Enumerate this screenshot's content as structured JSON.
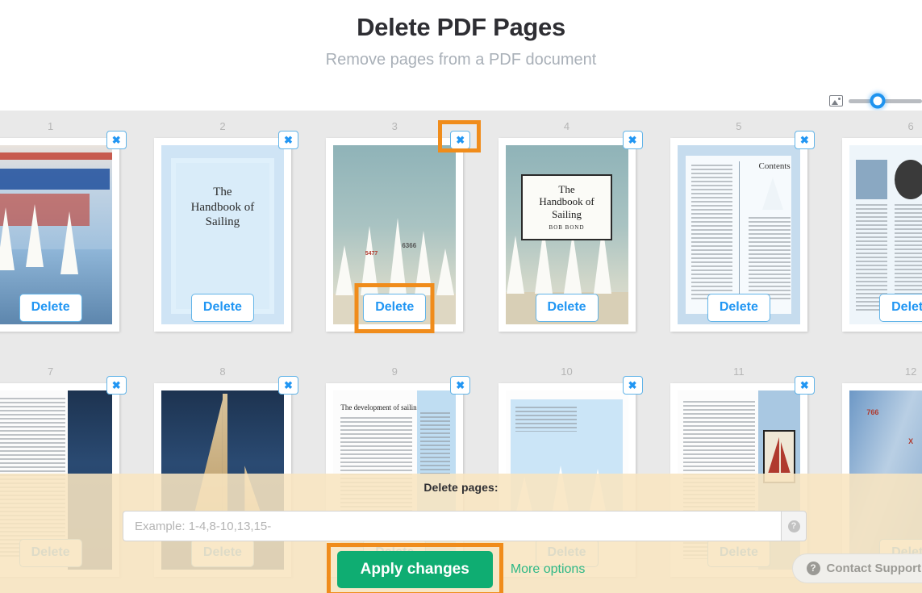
{
  "header": {
    "title": "Delete PDF Pages",
    "subtitle": "Remove pages from a PDF document"
  },
  "zoom_control": {
    "icon": "image-icon",
    "handle_position_percent": 40
  },
  "grid": {
    "close_label": "✖",
    "delete_label": "Delete",
    "pages": [
      {
        "number": "1",
        "art": "cover-photo",
        "title": ""
      },
      {
        "number": "2",
        "art": "pale-blue-title",
        "title": "The\nHandbook of\nSailing"
      },
      {
        "number": "3",
        "art": "sails-sky",
        "title": "",
        "highlighted": true
      },
      {
        "number": "4",
        "art": "boxed-title",
        "title": "The\nHandbook of\nSailing",
        "byline": "BOB BOND"
      },
      {
        "number": "5",
        "art": "contents-page",
        "title": ""
      },
      {
        "number": "6",
        "art": "index-page",
        "title": ""
      },
      {
        "number": "7",
        "art": "text-photo",
        "title": ""
      },
      {
        "number": "8",
        "art": "tan-sail-photo",
        "title": ""
      },
      {
        "number": "9",
        "art": "article-page",
        "title": ""
      },
      {
        "number": "10",
        "art": "boat-diagrams",
        "title": ""
      },
      {
        "number": "11",
        "art": "red-boat-page",
        "title": ""
      },
      {
        "number": "12",
        "art": "blue-sails",
        "title": ""
      }
    ]
  },
  "bottom_panel": {
    "label": "Delete pages:",
    "input_placeholder": "Example: 1-4,8-10,13,15-",
    "input_value": "",
    "help_icon": "question-mark-icon",
    "apply_label": "Apply changes",
    "more_options_label": "More options"
  },
  "contact": {
    "icon": "question-circle-icon",
    "label": "Contact Support"
  },
  "colors": {
    "accent_green": "#0fad72",
    "link_green": "#2eb886",
    "highlight_orange": "#f08c1b",
    "button_blue": "#2196f3",
    "panel_cream": "#f8e5c0",
    "grid_bg": "#e9e9e9"
  }
}
